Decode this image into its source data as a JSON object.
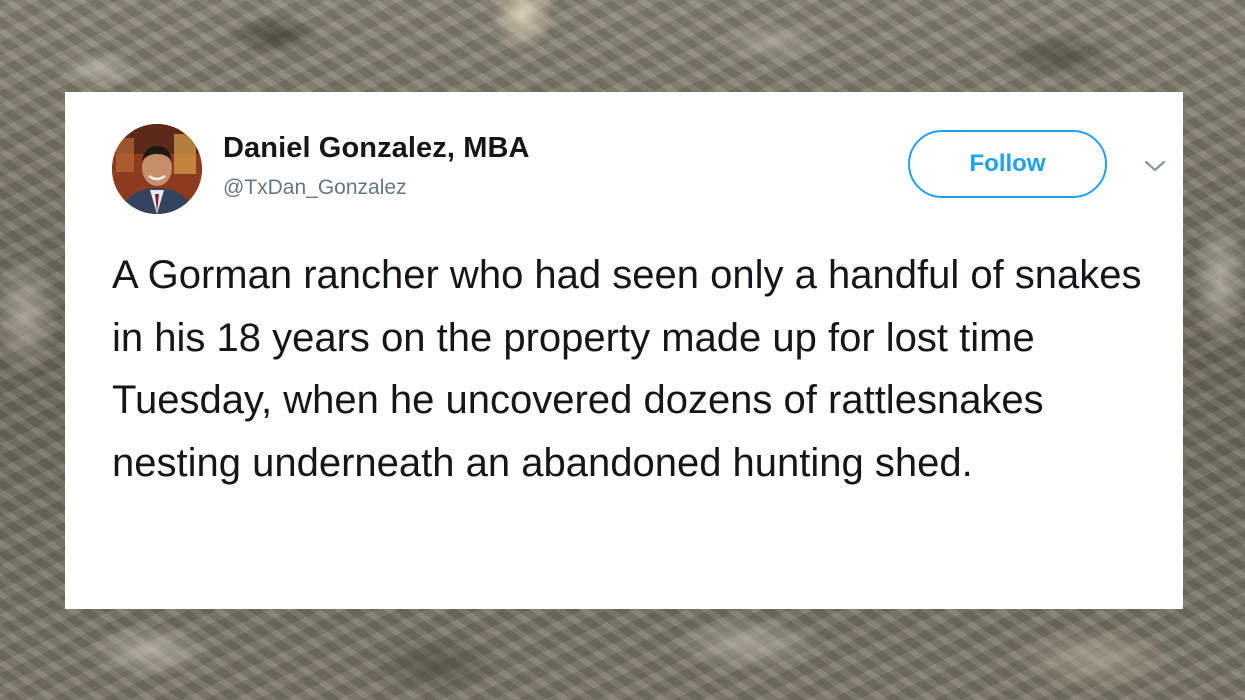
{
  "tweet": {
    "author_name": "Daniel Gonzalez, MBA",
    "author_handle": "@TxDan_Gonzalez",
    "follow_label": "Follow",
    "text": "A Gorman rancher who had seen only a handful of snakes in his 18 years on the property made up for lost time Tuesday, when he uncovered dozens of rattlesnakes nesting underneath an abandoned hunting shed."
  },
  "icons": {
    "avatar": "profile-photo",
    "menu": "chevron-down-icon"
  },
  "colors": {
    "accent": "#1da1f2",
    "text": "#14171a",
    "secondary_text": "#657786",
    "card_background": "#ffffff"
  }
}
